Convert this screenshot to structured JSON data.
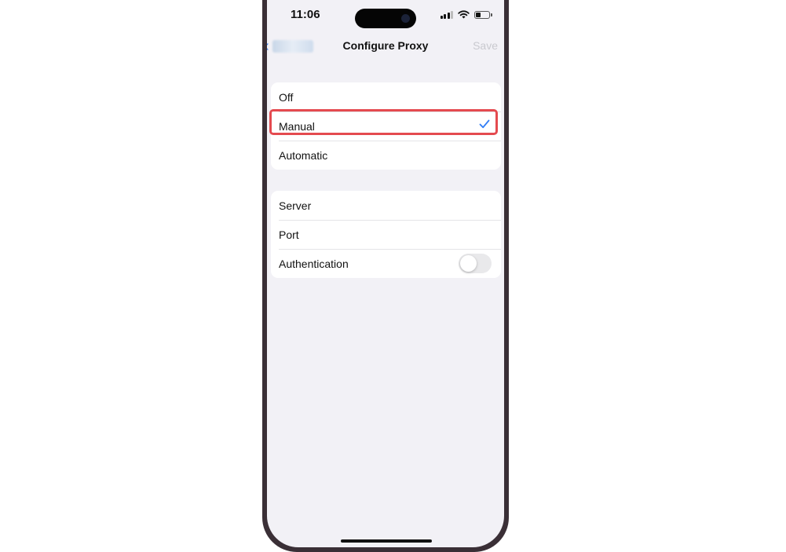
{
  "status": {
    "time": "11:06"
  },
  "nav": {
    "title": "Configure Proxy",
    "save_label": "Save",
    "back_icon": "chevron-left-icon"
  },
  "proxy_mode": {
    "options": [
      {
        "label": "Off",
        "selected": false
      },
      {
        "label": "Manual",
        "selected": true
      },
      {
        "label": "Automatic",
        "selected": false
      }
    ]
  },
  "manual_settings": {
    "server_label": "Server",
    "port_label": "Port",
    "authentication_label": "Authentication",
    "authentication_enabled": false
  },
  "colors": {
    "accent": "#2f7cf6",
    "highlight": "#e44a4f",
    "background": "#f2f1f6"
  }
}
